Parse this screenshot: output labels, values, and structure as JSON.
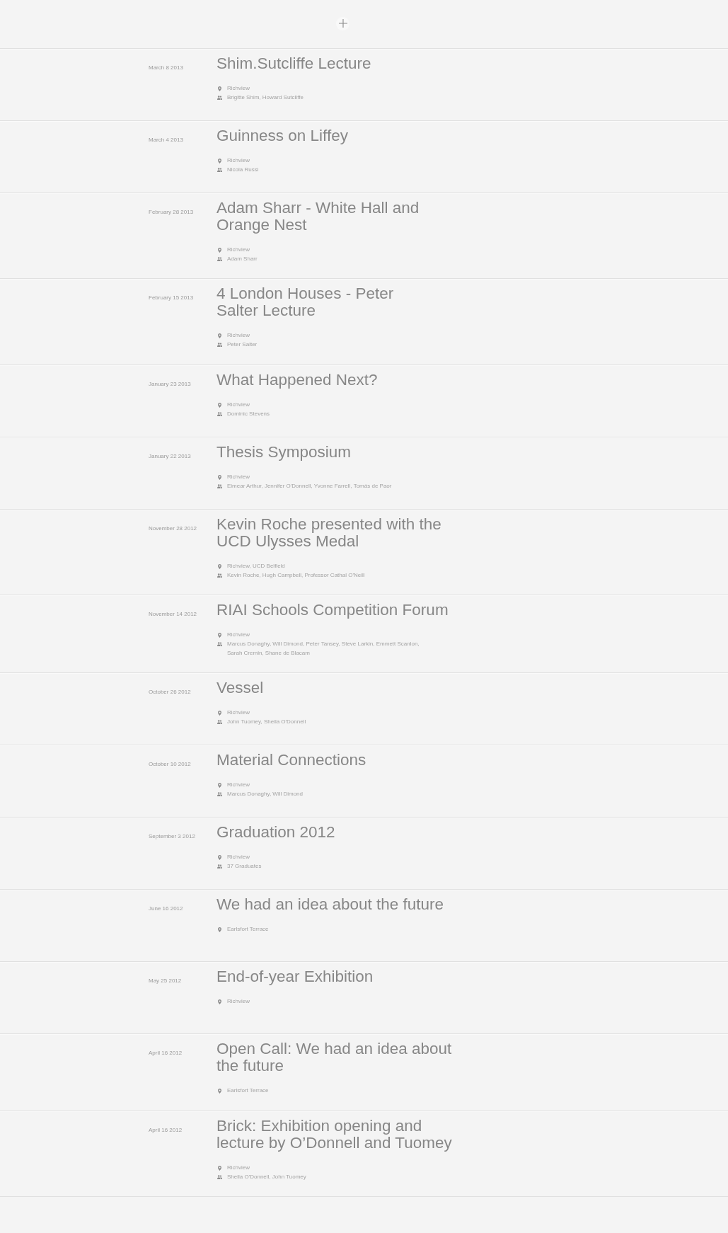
{
  "events": [
    {
      "date": "March 8 2013",
      "title": "Shim.Sutcliffe Lecture",
      "details": [
        {
          "kind": "location",
          "text": "Richview"
        },
        {
          "kind": "people",
          "text": "Brigitte Shim, Howard Sutcliffe"
        }
      ]
    },
    {
      "date": "March 4 2013",
      "title": "Guinness on Liffey",
      "details": [
        {
          "kind": "location",
          "text": "Richview"
        },
        {
          "kind": "people",
          "text": "Nicola Russi"
        }
      ]
    },
    {
      "date": "February 28 2013",
      "title": "Adam Sharr - White Hall and\nOrange Nest",
      "details": [
        {
          "kind": "location",
          "text": "Richview"
        },
        {
          "kind": "people",
          "text": "Adam Sharr"
        }
      ]
    },
    {
      "date": "February 15 2013",
      "title": "4 London Houses - Peter\nSalter Lecture",
      "details": [
        {
          "kind": "location",
          "text": "Richview"
        },
        {
          "kind": "people",
          "text": "Peter Salter"
        }
      ]
    },
    {
      "date": "January 23 2013",
      "title": "What Happened Next?",
      "details": [
        {
          "kind": "location",
          "text": "Richview"
        },
        {
          "kind": "people",
          "text": "Dominic Stevens"
        }
      ]
    },
    {
      "date": "January 22 2013",
      "title": "Thesis Symposium",
      "details": [
        {
          "kind": "location",
          "text": "Richview"
        },
        {
          "kind": "people",
          "text": "Eimear Arthur, Jennifer O'Donnell, Yvonne Farrell, Tomás de Paor"
        }
      ]
    },
    {
      "date": "November 28 2012",
      "title": "Kevin Roche presented with the\nUCD Ulysses Medal",
      "details": [
        {
          "kind": "location",
          "text": "Richview, UCD Belfield"
        },
        {
          "kind": "people",
          "text": "Kevin Roche, Hugh Campbell, Professor Cathal O'Neill"
        }
      ]
    },
    {
      "date": "November 14 2012",
      "title": "RIAI Schools Competition Forum",
      "details": [
        {
          "kind": "location",
          "text": "Richview"
        },
        {
          "kind": "people",
          "text": "Marcus Donaghy, Will Dimond, Peter Tansey, Steve Larkin, Emmett Scanlon, Sarah Cremin, Shane de Blacam"
        }
      ]
    },
    {
      "date": "October 26 2012",
      "title": "Vessel",
      "details": [
        {
          "kind": "location",
          "text": "Richview"
        },
        {
          "kind": "people",
          "text": "John Tuomey, Sheila O'Donnell"
        }
      ]
    },
    {
      "date": "October 10 2012",
      "title": "Material Connections",
      "details": [
        {
          "kind": "location",
          "text": "Richview"
        },
        {
          "kind": "people",
          "text": "Marcus Donaghy, Will Dimond"
        }
      ]
    },
    {
      "date": "September 3 2012",
      "title": "Graduation 2012",
      "details": [
        {
          "kind": "location",
          "text": "Richview"
        },
        {
          "kind": "people",
          "text": "37 Graduates"
        }
      ]
    },
    {
      "date": "June 16 2012",
      "title": "We had an idea about the future",
      "details": [
        {
          "kind": "location",
          "text": "Earlsfort Terrace"
        }
      ]
    },
    {
      "date": "May 25 2012",
      "title": "End-of-year Exhibition",
      "details": [
        {
          "kind": "location",
          "text": "Richview"
        }
      ]
    },
    {
      "date": "April 16 2012",
      "title": "Open Call: We had an idea about\nthe future",
      "details": [
        {
          "kind": "location",
          "text": "Earlsfort Terrace"
        }
      ]
    },
    {
      "date": "April 16 2012",
      "title": "Brick: Exhibition opening and\nlecture by O’Donnell and Tuomey",
      "details": [
        {
          "kind": "location",
          "text": "Richview"
        },
        {
          "kind": "people",
          "text": "Sheila O'Donnell, John Tuomey"
        }
      ]
    }
  ]
}
